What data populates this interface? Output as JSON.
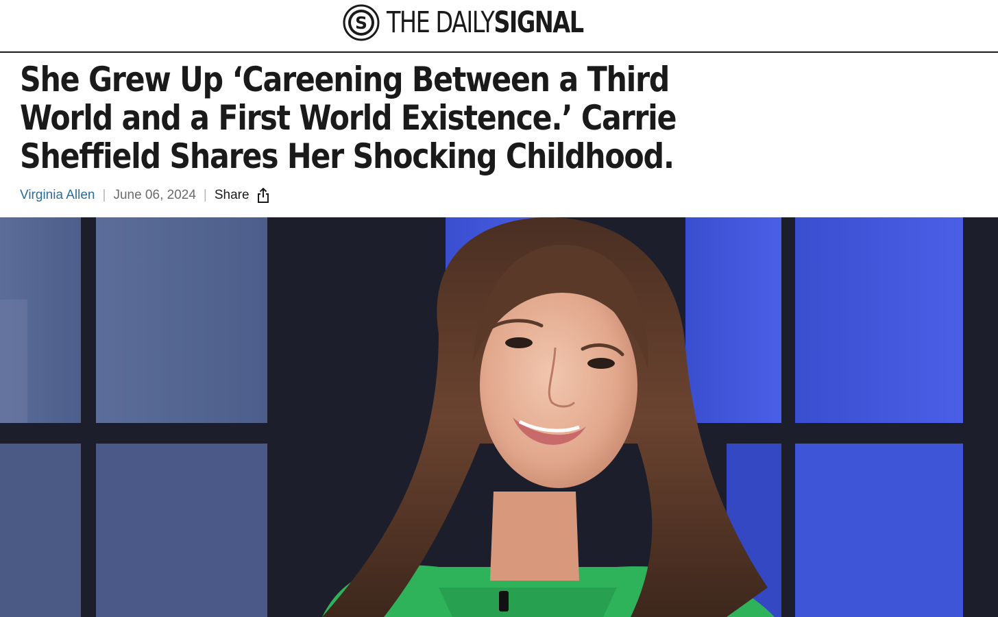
{
  "site": {
    "logo_light": "THE DAILY",
    "logo_bold": "SIGNAL",
    "logo_mark_letter": "S"
  },
  "article": {
    "title": "She Grew Up ‘Careening Between a Third World and a First World Existence.’ Carrie Sheffield Shares Her Shocking Childhood.",
    "author": "Virginia Allen",
    "date": "June 06, 2024",
    "share_label": "Share",
    "share_icon": "share-icon"
  },
  "colors": {
    "author_link": "#2c6c98",
    "text": "#1a1a1a",
    "meta": "#6b6b6b"
  }
}
